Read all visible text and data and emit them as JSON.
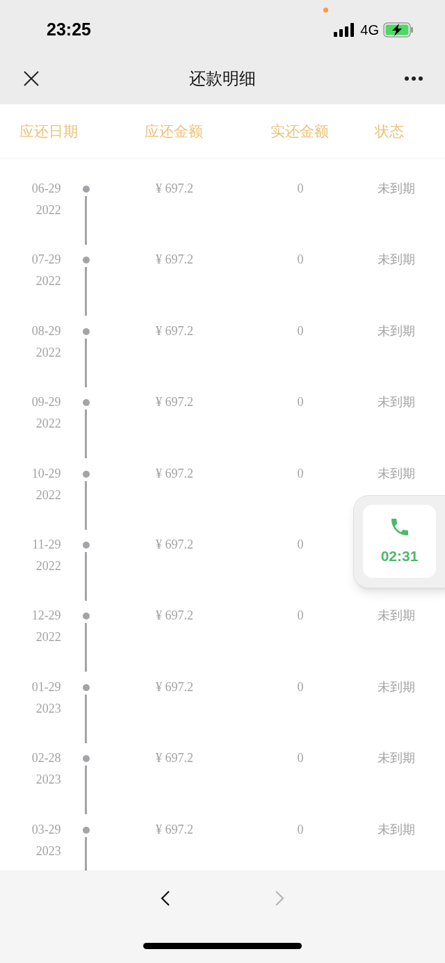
{
  "status_bar": {
    "time": "23:25",
    "network": "4G"
  },
  "nav": {
    "title": "还款明细"
  },
  "table": {
    "columns": [
      "应还日期",
      "应还金额",
      "实还金额",
      "状态"
    ],
    "rows": [
      {
        "date": "06-29",
        "year": "2022",
        "amount": "¥ 697.2",
        "paid": "0",
        "status": "未到期"
      },
      {
        "date": "07-29",
        "year": "2022",
        "amount": "¥ 697.2",
        "paid": "0",
        "status": "未到期"
      },
      {
        "date": "08-29",
        "year": "2022",
        "amount": "¥ 697.2",
        "paid": "0",
        "status": "未到期"
      },
      {
        "date": "09-29",
        "year": "2022",
        "amount": "¥ 697.2",
        "paid": "0",
        "status": "未到期"
      },
      {
        "date": "10-29",
        "year": "2022",
        "amount": "¥ 697.2",
        "paid": "0",
        "status": "未到期"
      },
      {
        "date": "11-29",
        "year": "2022",
        "amount": "¥ 697.2",
        "paid": "0"
      },
      {
        "date": "12-29",
        "year": "2022",
        "amount": "¥ 697.2",
        "paid": "0",
        "status": "未到期"
      },
      {
        "date": "01-29",
        "year": "2023",
        "amount": "¥ 697.2",
        "paid": "0",
        "status": "未到期"
      },
      {
        "date": "02-28",
        "year": "2023",
        "amount": "¥ 697.2",
        "paid": "0",
        "status": "未到期"
      },
      {
        "date": "03-29",
        "year": "2023",
        "amount": "¥ 697.2",
        "paid": "0",
        "status": "未到期"
      }
    ]
  },
  "call_bubble": {
    "duration": "02:31"
  },
  "toolbar": [
    {
      "kind": "back",
      "disabled": false
    },
    {
      "kind": "forward",
      "disabled": true
    }
  ]
}
